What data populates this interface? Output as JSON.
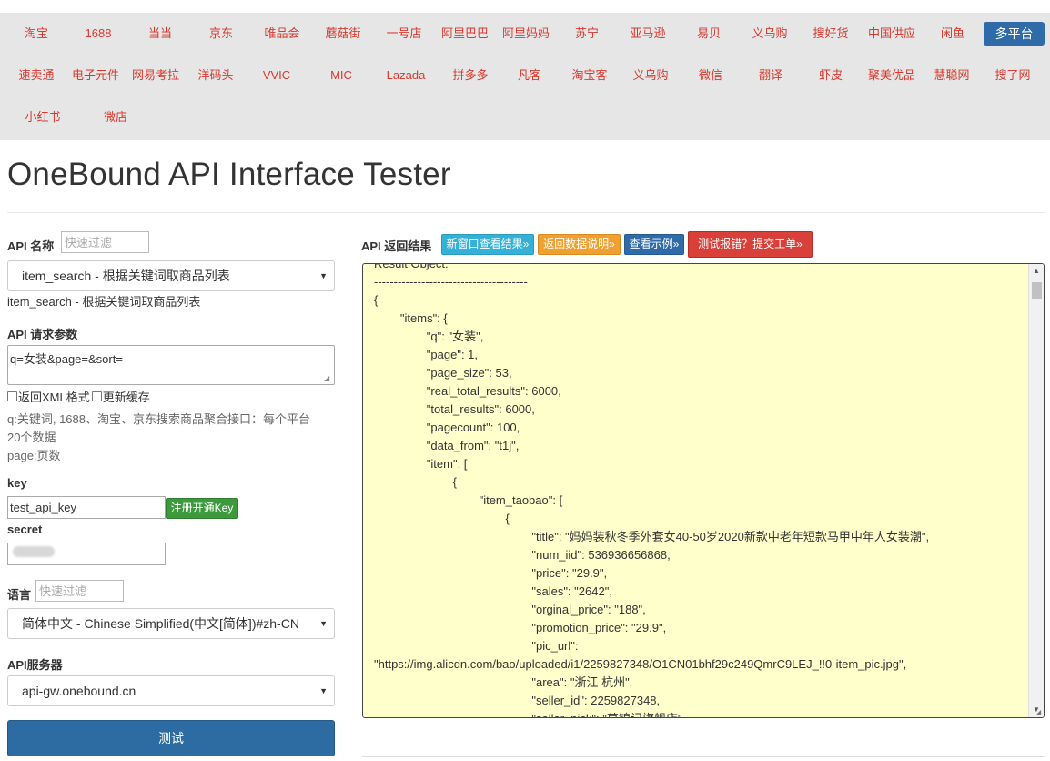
{
  "platform_nav": {
    "rows": [
      [
        "淘宝",
        "1688",
        "当当",
        "京东",
        "唯品会",
        "蘑菇街",
        "一号店",
        "阿里巴巴",
        "阿里妈妈",
        "苏宁",
        "亚马逊",
        "易贝",
        "义乌购",
        "搜好货",
        "中国供应",
        "闲鱼",
        "多平台"
      ],
      [
        "速卖通",
        "电子元件",
        "网易考拉",
        "洋码头",
        "VVIC",
        "MIC",
        "Lazada",
        "拼多多",
        "凡客",
        "淘宝客",
        "义乌购",
        "微信",
        "翻译",
        "虾皮",
        "聚美优品",
        "慧聪网",
        "搜了网"
      ],
      [
        "小红书",
        "微店"
      ]
    ],
    "active": "多平台",
    "colors": {
      "link": "#d9392f",
      "active_bg": "#2f6ba8",
      "bar_bg": "#e6e6e6"
    }
  },
  "page": {
    "title": "OneBound API Interface Tester"
  },
  "form": {
    "api_name_label": "API 名称",
    "filter_placeholder": "快速过滤",
    "api_select_value": "item_search - 根据关键词取商品列表",
    "api_description": "item_search - 根据关键词取商品列表",
    "params_label": "API 请求参数",
    "params_value": "q=女装&page=&sort=",
    "checkbox_xml": "返回XML格式",
    "checkbox_cache": "更新缓存",
    "param_help_1": "q:关键词, 1688、淘宝、京东搜索商品聚合接口：每个平台",
    "param_help_2": "20个数据",
    "param_help_3": "page:页数",
    "key_label": "key",
    "key_value": "test_api_key",
    "register_button": "注册开通Key",
    "secret_label": "secret",
    "lang_label": "语言",
    "lang_filter_placeholder": "快速过滤",
    "lang_select_value": "简体中文 - Chinese Simplified(中文[简体])#zh-CN",
    "server_label": "API服务器",
    "server_select_value": "api-gw.onebound.cn",
    "submit_button": "测试"
  },
  "result": {
    "label": "API 返回结果",
    "btn_new_window": "新窗口查看结果»",
    "btn_docs": "返回数据说明»",
    "btn_example": "查看示例»",
    "btn_report": "测试报错？提交工单»",
    "code_lines": [
      "Result Object:",
      "---------------------------------------",
      "{",
      "        \"items\": {",
      "                \"q\": \"女装\",",
      "                \"page\": 1,",
      "                \"page_size\": 53,",
      "                \"real_total_results\": 6000,",
      "                \"total_results\": 6000,",
      "                \"pagecount\": 100,",
      "                \"data_from\": \"t1j\",",
      "                \"item\": [",
      "                        {",
      "                                \"item_taobao\": [",
      "                                        {",
      "                                                \"title\": \"妈妈装秋冬季外套女40-50岁2020新款中老年短款马甲中年人女装潮\",",
      "                                                \"num_iid\": 536936656868,",
      "                                                \"price\": \"29.9\",",
      "                                                \"sales\": \"2642\",",
      "                                                \"orginal_price\": \"188\",",
      "                                                \"promotion_price\": \"29.9\",",
      "                                                \"pic_url\":",
      "\"https://img.alicdn.com/bao/uploaded/i1/2259827348/O1CN01bhf29c249QmrC9LEJ_!!0-item_pic.jpg\",",
      "                                                \"area\": \"浙江 杭州\",",
      "                                                \"seller_id\": 2259827348,",
      "                                                \"seller_nick\": \"草锦记旗舰店\","
    ],
    "box_bg": "#ffffcc"
  }
}
